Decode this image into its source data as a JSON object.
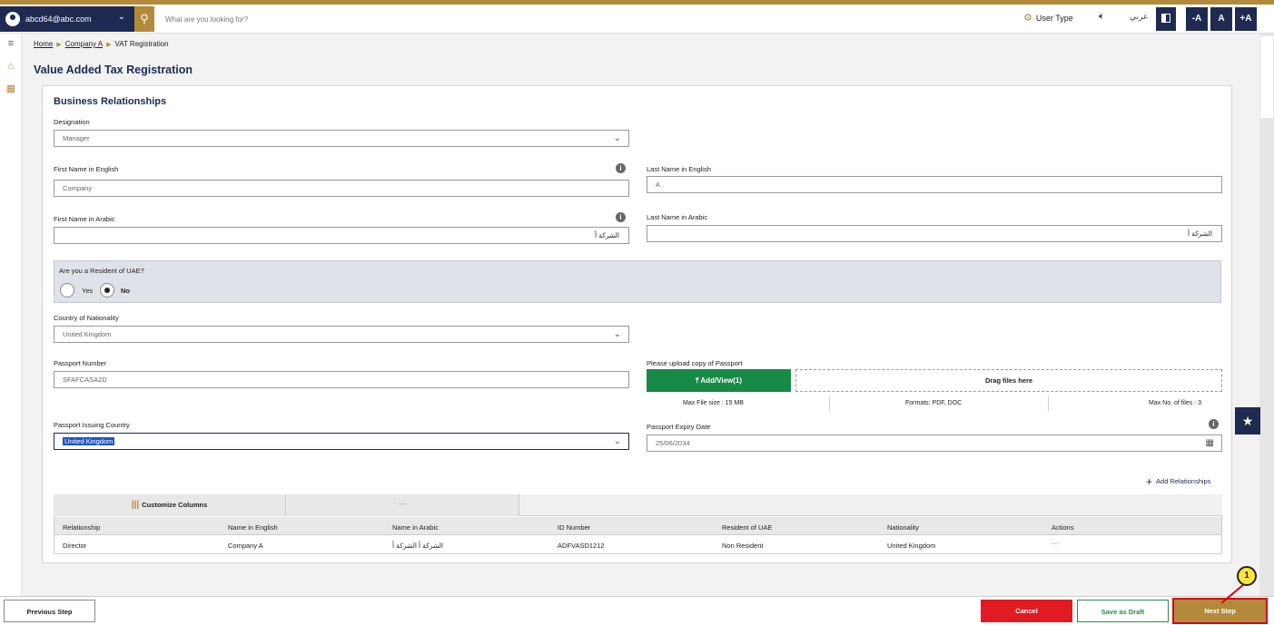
{
  "header": {
    "account_email": "abcd64@abc.com",
    "search_placeholder": "What are you looking for?",
    "user_type": "User Type",
    "language": "عربي",
    "font_decrease": "-A",
    "font_normal": "A",
    "font_increase": "+A"
  },
  "breadcrumb": {
    "home": "Home",
    "company": "Company A",
    "current": "VAT Registration"
  },
  "page_title": "Value Added Tax Registration",
  "section": {
    "title": "Business Relationships",
    "designation": {
      "label": "Designation",
      "value": "Manager"
    },
    "first_name_en": {
      "label": "First Name in English",
      "value": "Company"
    },
    "last_name_en": {
      "label": "Last Name in English",
      "value": "A"
    },
    "first_name_ar": {
      "label": "First Name in Arabic",
      "value": "الشركة أ"
    },
    "last_name_ar": {
      "label": "Last Name in Arabic",
      "value": "الشركة أ"
    },
    "resident": {
      "question": "Are you a Resident of UAE?",
      "yes": "Yes",
      "no": "No",
      "selected": "No"
    },
    "nationality": {
      "label": "Country of Nationality",
      "value": "United Kingdom"
    },
    "passport_number": {
      "label": "Passport Number",
      "value": "SFAFCASA2D"
    },
    "passport_upload": {
      "label": "Please upload copy of Passport",
      "button": "Add/View(1)",
      "dropzone": "Drag files here",
      "max_size": "Max File size : 15 MB",
      "formats": "Formats: PDF, DOC",
      "max_files": "Max No. of files : 3"
    },
    "issuing_country": {
      "label": "Passport Issuing Country",
      "value": "United Kingdom"
    },
    "expiry": {
      "label": "Passport Expiry Date",
      "value": "25/06/2034"
    },
    "add_relationships": "Add Relationships"
  },
  "table": {
    "customize": "Customize Columns",
    "more": "···",
    "columns": [
      "Relationship",
      "Name in English",
      "Name in Arabic",
      "ID Number",
      "Resident of UAE",
      "Nationality",
      "Actions"
    ],
    "rows": [
      [
        "Director",
        "Company A",
        "الشركة أ الشركة أ",
        "ADFVASD1212",
        "Non Resident",
        "United Kingdom",
        "···"
      ]
    ]
  },
  "footer": {
    "previous": "Previous Step",
    "cancel": "Cancel",
    "draft": "Save as Draft",
    "next": "Next Step",
    "callout": "1"
  },
  "colors": {
    "navy": "#1e2a52",
    "gold": "#b38a3a",
    "green": "#178a47",
    "red": "#e21b23"
  }
}
